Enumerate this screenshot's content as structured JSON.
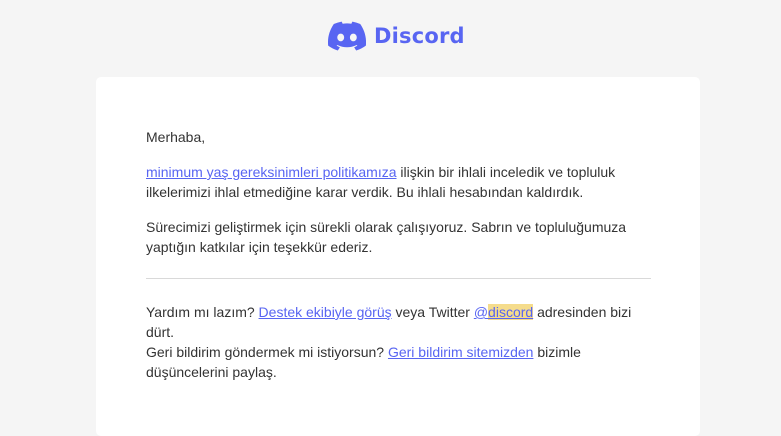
{
  "brand": {
    "name": "Discord",
    "color": "#5865f2",
    "icon": "discord-logo-icon"
  },
  "email": {
    "greeting": "Merhaba,",
    "paragraph1": {
      "link_text": "minimum yaş gereksinimleri politikamıza",
      "text": " ilişkin bir ihlali inceledik ve topluluk ilkelerimizi ihlal etmediğine karar verdik. Bu ihlali hesabından kaldırdık."
    },
    "paragraph2": "Sürecimizi geliştirmek için sürekli olarak çalışıyoruz. Sabrın ve topluluğumuza yaptığın katkılar için teşekkür ederiz."
  },
  "footer": {
    "help_prefix": "Yardım mı lazım? ",
    "help_link": "Destek ekibiyle görüş",
    "help_middle": " veya Twitter ",
    "twitter_at": "@",
    "twitter_handle": "discord",
    "help_suffix": " adresinden bizi dürt.",
    "feedback_prefix": "Geri bildirim göndermek mi istiyorsun? ",
    "feedback_link": "Geri bildirim sitemizden",
    "feedback_suffix": " bizimle düşüncelerini paylaş."
  }
}
